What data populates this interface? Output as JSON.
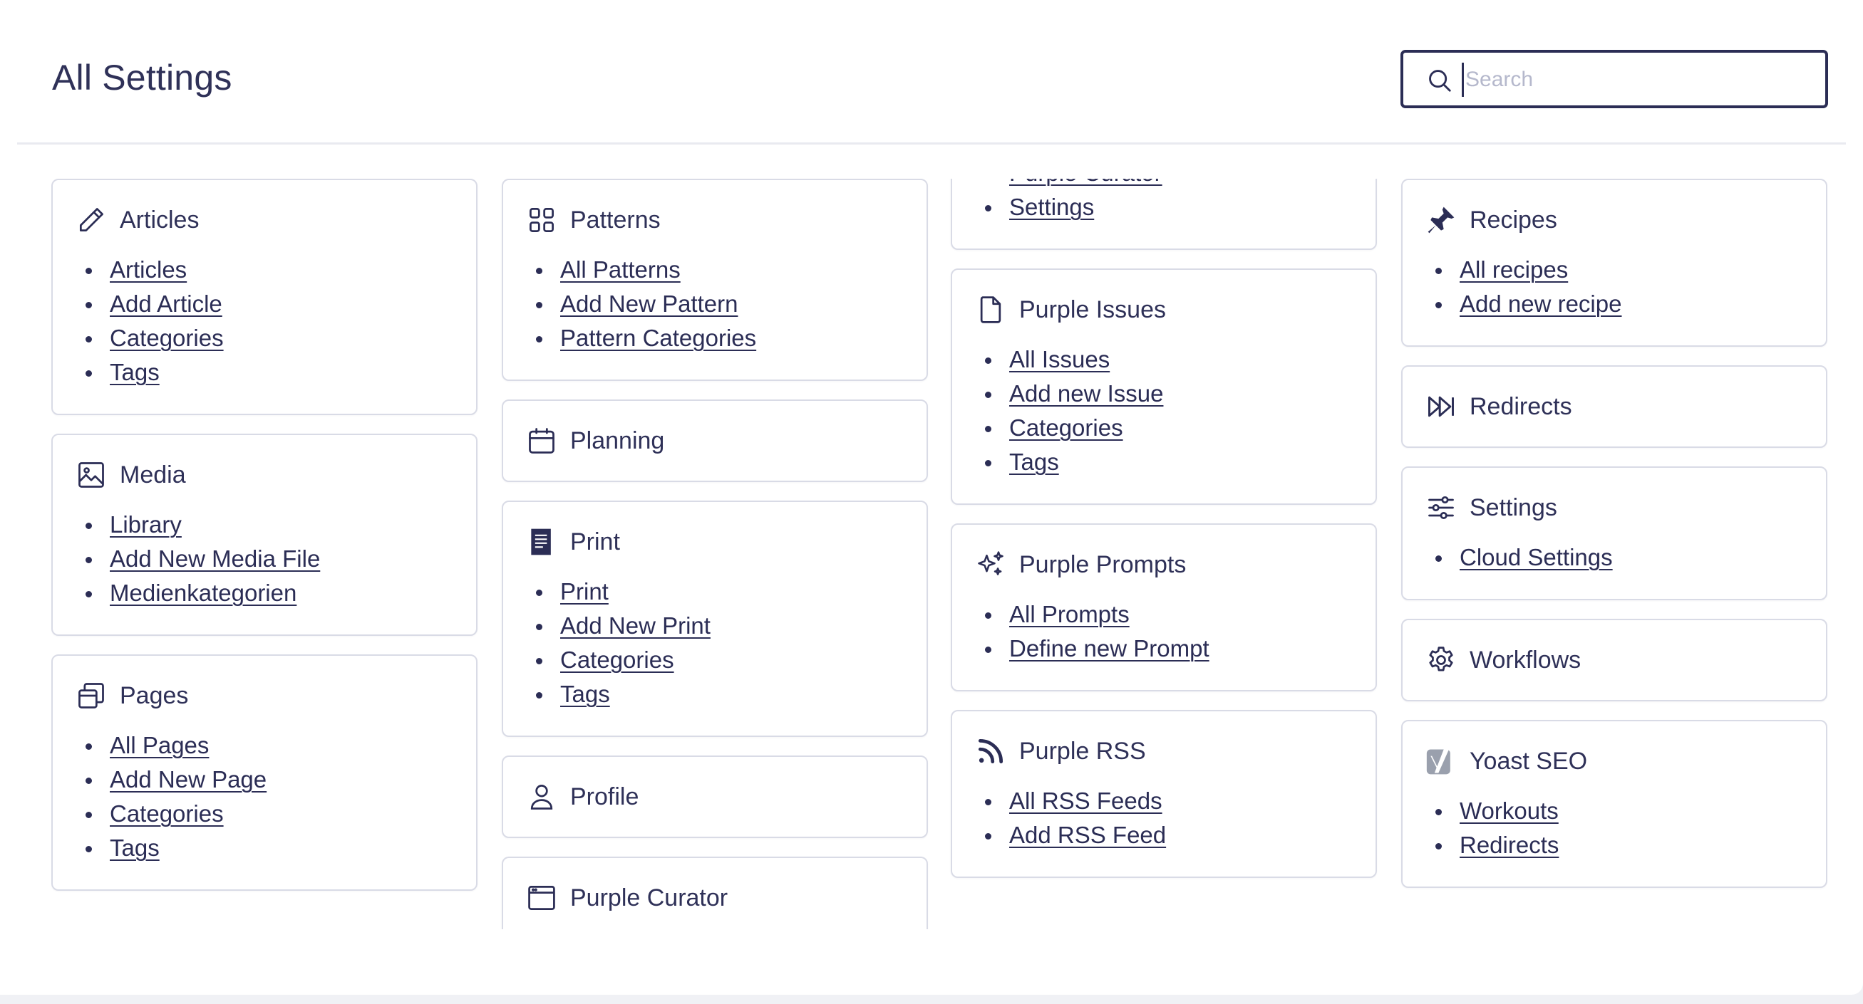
{
  "header": {
    "title": "All Settings",
    "search_placeholder": "Search"
  },
  "colors": {
    "text": "#2b2d55",
    "border": "#d9dbe6",
    "background": "#ffffff"
  },
  "columns": [
    [
      {
        "id": "articles",
        "icon": "pencil-icon",
        "title": "Articles",
        "links": [
          "Articles",
          "Add Article",
          "Categories",
          "Tags"
        ]
      },
      {
        "id": "media",
        "icon": "image-icon",
        "title": "Media",
        "links": [
          "Library",
          "Add New Media File",
          "Medienkategorien"
        ]
      },
      {
        "id": "pages",
        "icon": "pages-icon",
        "title": "Pages",
        "links": [
          "All Pages",
          "Add New Page",
          "Categories",
          "Tags"
        ]
      }
    ],
    [
      {
        "id": "patterns",
        "icon": "grid-icon",
        "title": "Patterns",
        "links": [
          "All Patterns",
          "Add New Pattern",
          "Pattern Categories"
        ]
      },
      {
        "id": "planning",
        "icon": "calendar-icon",
        "title": "Planning",
        "links": []
      },
      {
        "id": "print",
        "icon": "document-icon",
        "title": "Print",
        "links": [
          "Print",
          "Add New Print",
          "Categories",
          "Tags"
        ]
      },
      {
        "id": "profile",
        "icon": "user-icon",
        "title": "Profile",
        "links": []
      },
      {
        "id": "purple-curator",
        "icon": "window-icon",
        "title": "Purple Curator",
        "links": []
      }
    ],
    [
      {
        "id": "purple-curator-cont",
        "icon": "",
        "title": "",
        "links": [
          "Purple Curator",
          "Settings"
        ]
      },
      {
        "id": "purple-issues",
        "icon": "file-icon",
        "title": "Purple Issues",
        "links": [
          "All Issues",
          "Add new Issue",
          "Categories",
          "Tags"
        ]
      },
      {
        "id": "purple-prompts",
        "icon": "sparkles-icon",
        "title": "Purple Prompts",
        "links": [
          "All Prompts",
          "Define new Prompt"
        ]
      },
      {
        "id": "purple-rss",
        "icon": "rss-icon",
        "title": "Purple RSS",
        "links": [
          "All RSS Feeds",
          "Add RSS Feed"
        ]
      }
    ],
    [
      {
        "id": "recipes",
        "icon": "pin-icon",
        "title": "Recipes",
        "links": [
          "All recipes",
          "Add new recipe"
        ]
      },
      {
        "id": "redirects",
        "icon": "forward-icon",
        "title": "Redirects",
        "links": []
      },
      {
        "id": "settings",
        "icon": "sliders-icon",
        "title": "Settings",
        "links": [
          "Cloud Settings"
        ]
      },
      {
        "id": "workflows",
        "icon": "gear-icon",
        "title": "Workflows",
        "links": []
      },
      {
        "id": "yoast-seo",
        "icon": "yoast-icon",
        "title": "Yoast SEO",
        "links": [
          "Workouts",
          "Redirects"
        ]
      }
    ]
  ]
}
